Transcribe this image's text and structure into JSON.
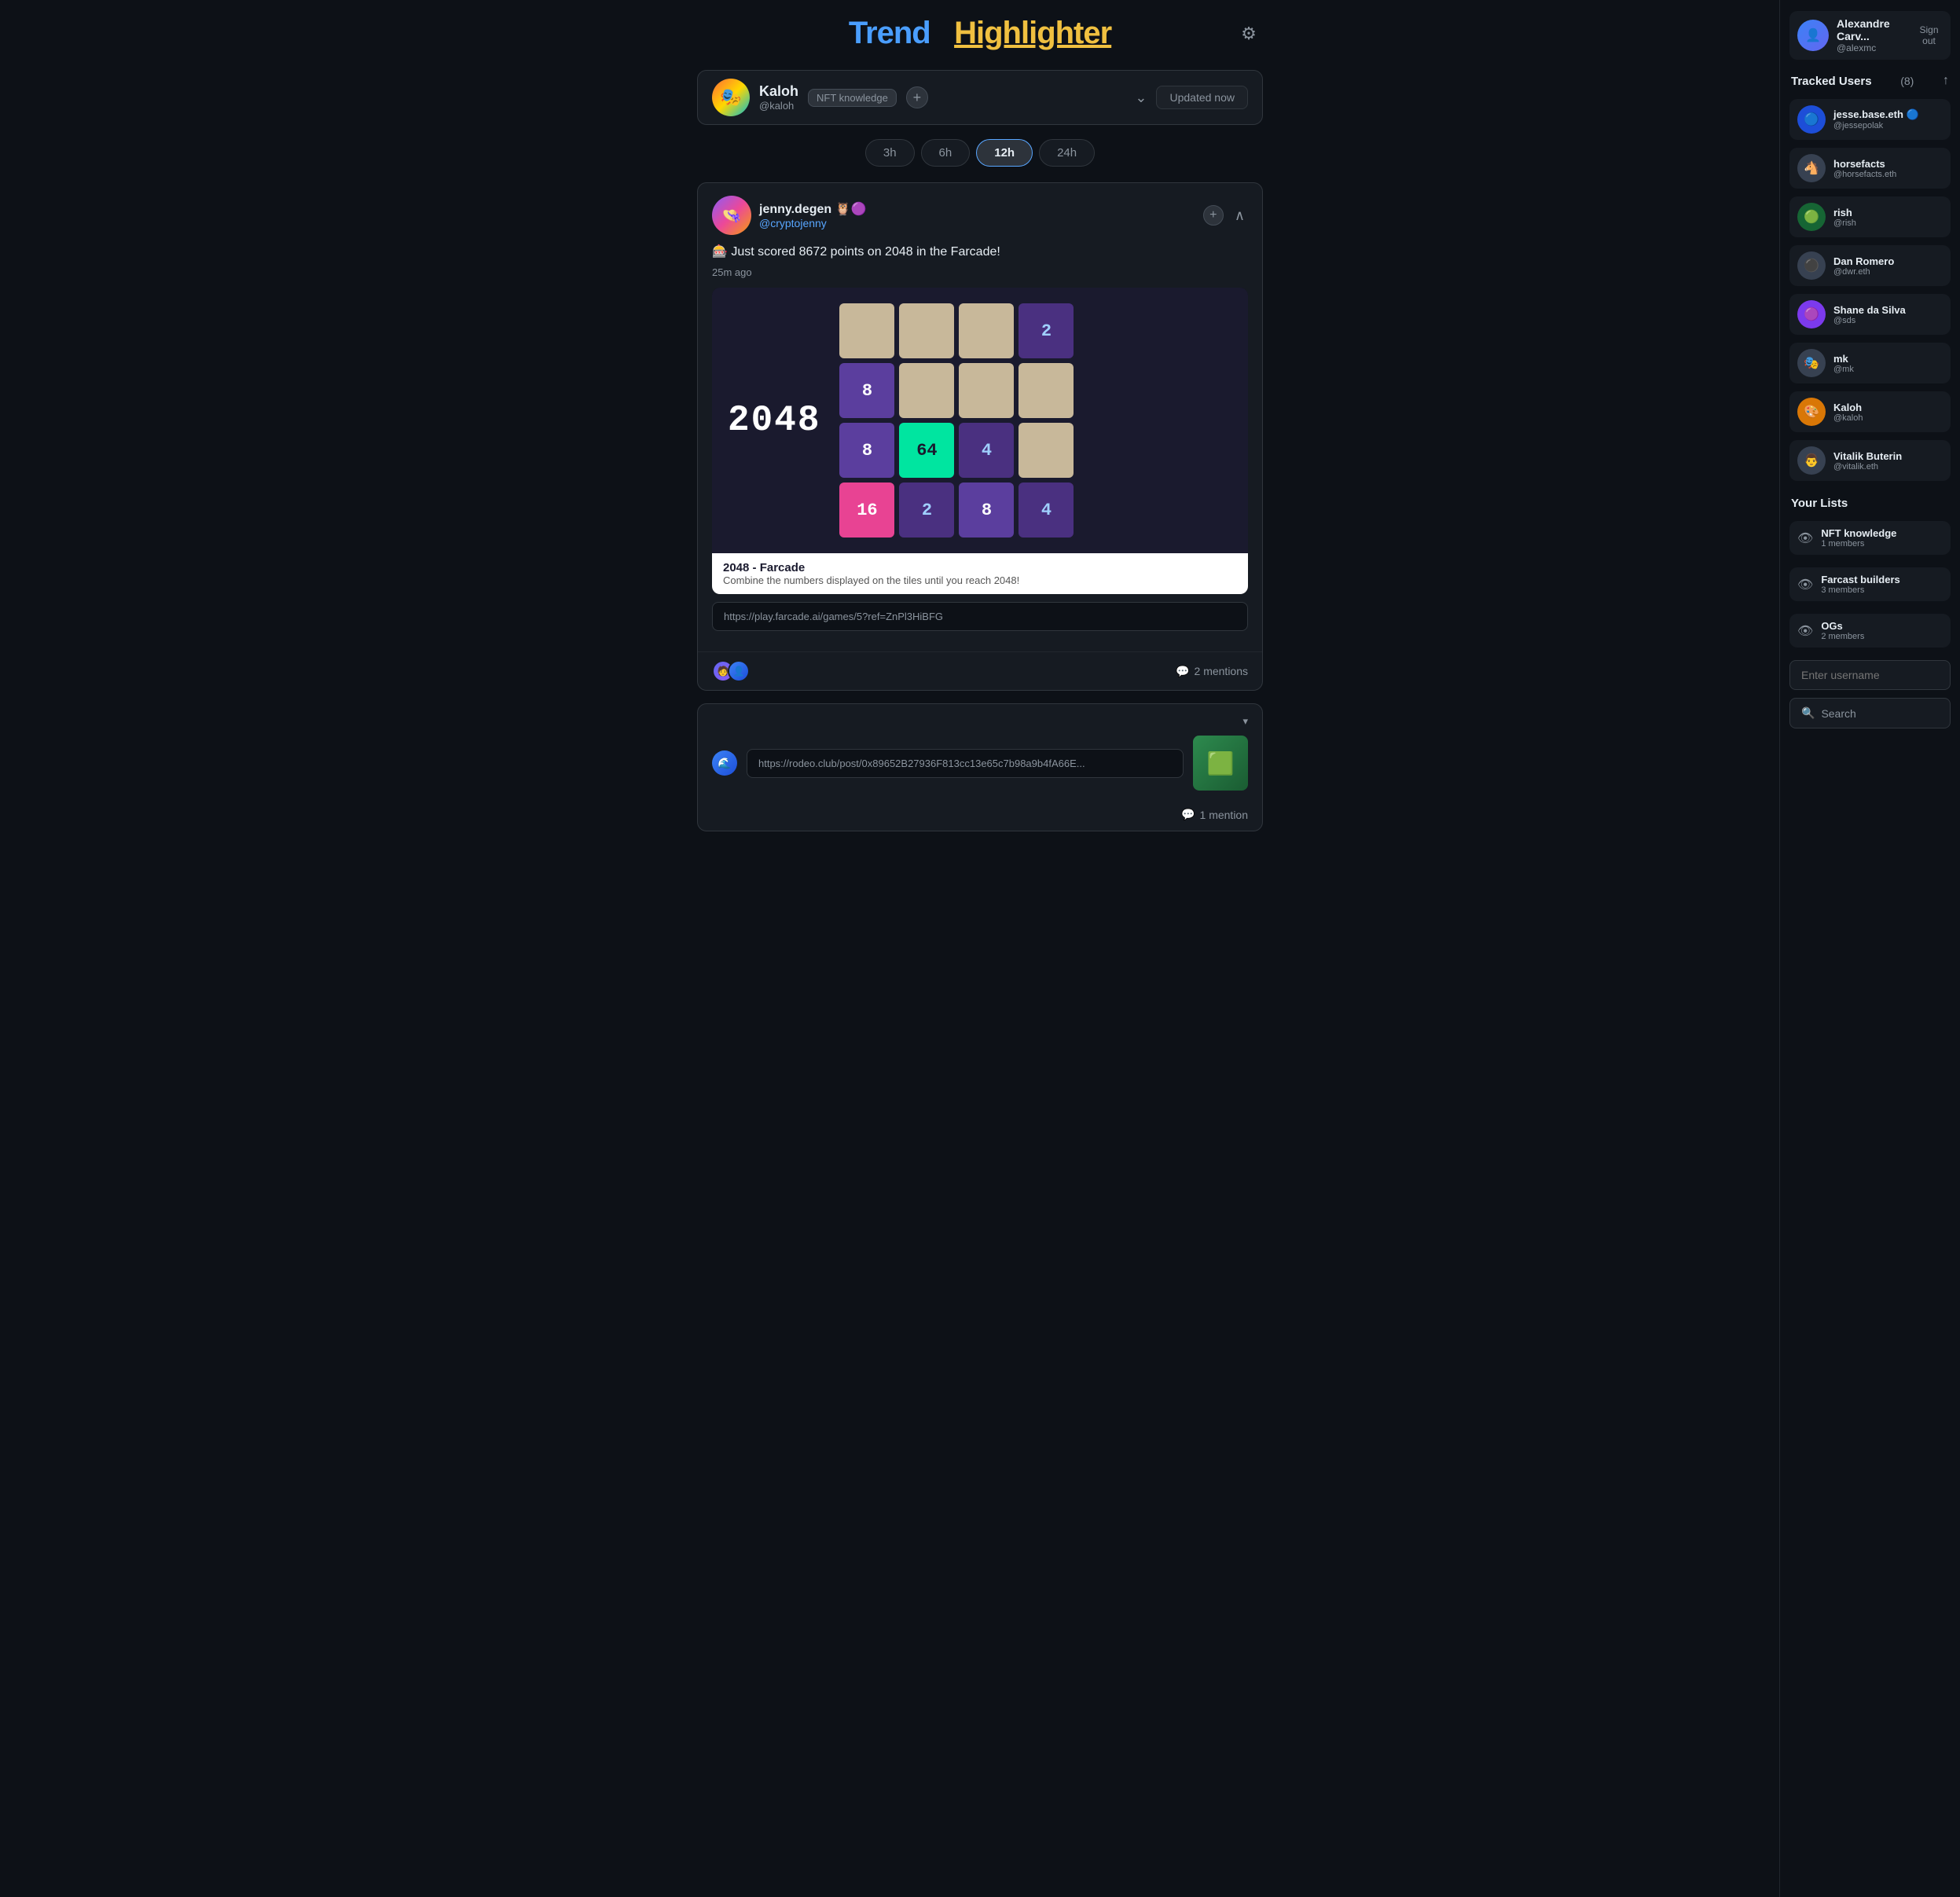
{
  "header": {
    "logo_trend": "Trend",
    "logo_highlighter": "Highlighter",
    "settings_icon": "⚙"
  },
  "list_selector": {
    "username": "Kaloh",
    "handle": "@kaloh",
    "tag": "NFT knowledge",
    "add_label": "+",
    "updated_label": "Updated now",
    "avatar_emoji": "🎭"
  },
  "time_tabs": [
    {
      "label": "3h",
      "active": false
    },
    {
      "label": "6h",
      "active": false
    },
    {
      "label": "12h",
      "active": true
    },
    {
      "label": "24h",
      "active": false
    }
  ],
  "post": {
    "username": "jenny.degen 🦉🟣",
    "handle": "@cryptojenny",
    "add_label": "+",
    "text": "🎰 Just scored 8672 points on 2048 in the Farcade!",
    "time": "25m ago",
    "game_title": "2048",
    "game_embed_title": "2048 - Farcade",
    "game_embed_desc": "Combine the numbers displayed on the tiles until you reach 2048!",
    "link": "https://play.farcade.ai/games/5?ref=ZnPl3HiBFG",
    "mentions": "2 mentions",
    "avatar_emoji": "👒"
  },
  "post2": {
    "link": "https://rodeo.club/post/0x89652B27936F813cc13e65c7b98a9b4fA66E...",
    "mentions": "1 mention",
    "collapse_icon": "▾"
  },
  "sidebar": {
    "user": {
      "name": "Alexandre Carv...",
      "handle": "@alexmc",
      "sign_out": "Sign out"
    },
    "tracked_users_title": "Tracked Users",
    "tracked_users_count": "(8)",
    "users": [
      {
        "name": "jesse.base.eth 🔵",
        "handle": "@jessepolak",
        "color": "#1d4ed8"
      },
      {
        "name": "horsefacts",
        "handle": "@horsefacts.eth",
        "color": "#374151"
      },
      {
        "name": "rish",
        "handle": "@rish",
        "color": "#166534"
      },
      {
        "name": "Dan Romero",
        "handle": "@dwr.eth",
        "color": "#374151"
      },
      {
        "name": "Shane da Silva",
        "handle": "@sds",
        "color": "#7c3aed"
      },
      {
        "name": "mk",
        "handle": "@mk",
        "color": "#374151"
      },
      {
        "name": "Kaloh",
        "handle": "@kaloh",
        "color": "#d97706"
      },
      {
        "name": "Vitalik Buterin",
        "handle": "@vitalik.eth",
        "color": "#374151"
      }
    ],
    "your_lists_title": "Your Lists",
    "lists": [
      {
        "name": "NFT knowledge",
        "count": "1 members"
      },
      {
        "name": "Farcast builders",
        "count": "3 members"
      },
      {
        "name": "OGs",
        "count": "2 members"
      }
    ],
    "username_placeholder": "Enter username",
    "search_label": "Search"
  },
  "game_tiles": [
    [
      {
        "value": "",
        "type": "empty"
      },
      {
        "value": "",
        "type": "empty"
      },
      {
        "value": "",
        "type": "empty"
      },
      {
        "value": "2",
        "type": "2"
      }
    ],
    [
      {
        "value": "8",
        "type": "8"
      },
      {
        "value": "",
        "type": "empty"
      },
      {
        "value": "",
        "type": "empty"
      },
      {
        "value": "",
        "type": "empty"
      }
    ],
    [
      {
        "value": "8",
        "type": "8"
      },
      {
        "value": "64",
        "type": "64"
      },
      {
        "value": "4",
        "type": "4"
      },
      {
        "value": "",
        "type": "empty"
      }
    ],
    [
      {
        "value": "16",
        "type": "16"
      },
      {
        "value": "2",
        "type": "2"
      },
      {
        "value": "8",
        "type": "8"
      },
      {
        "value": "4",
        "type": "4"
      }
    ]
  ]
}
